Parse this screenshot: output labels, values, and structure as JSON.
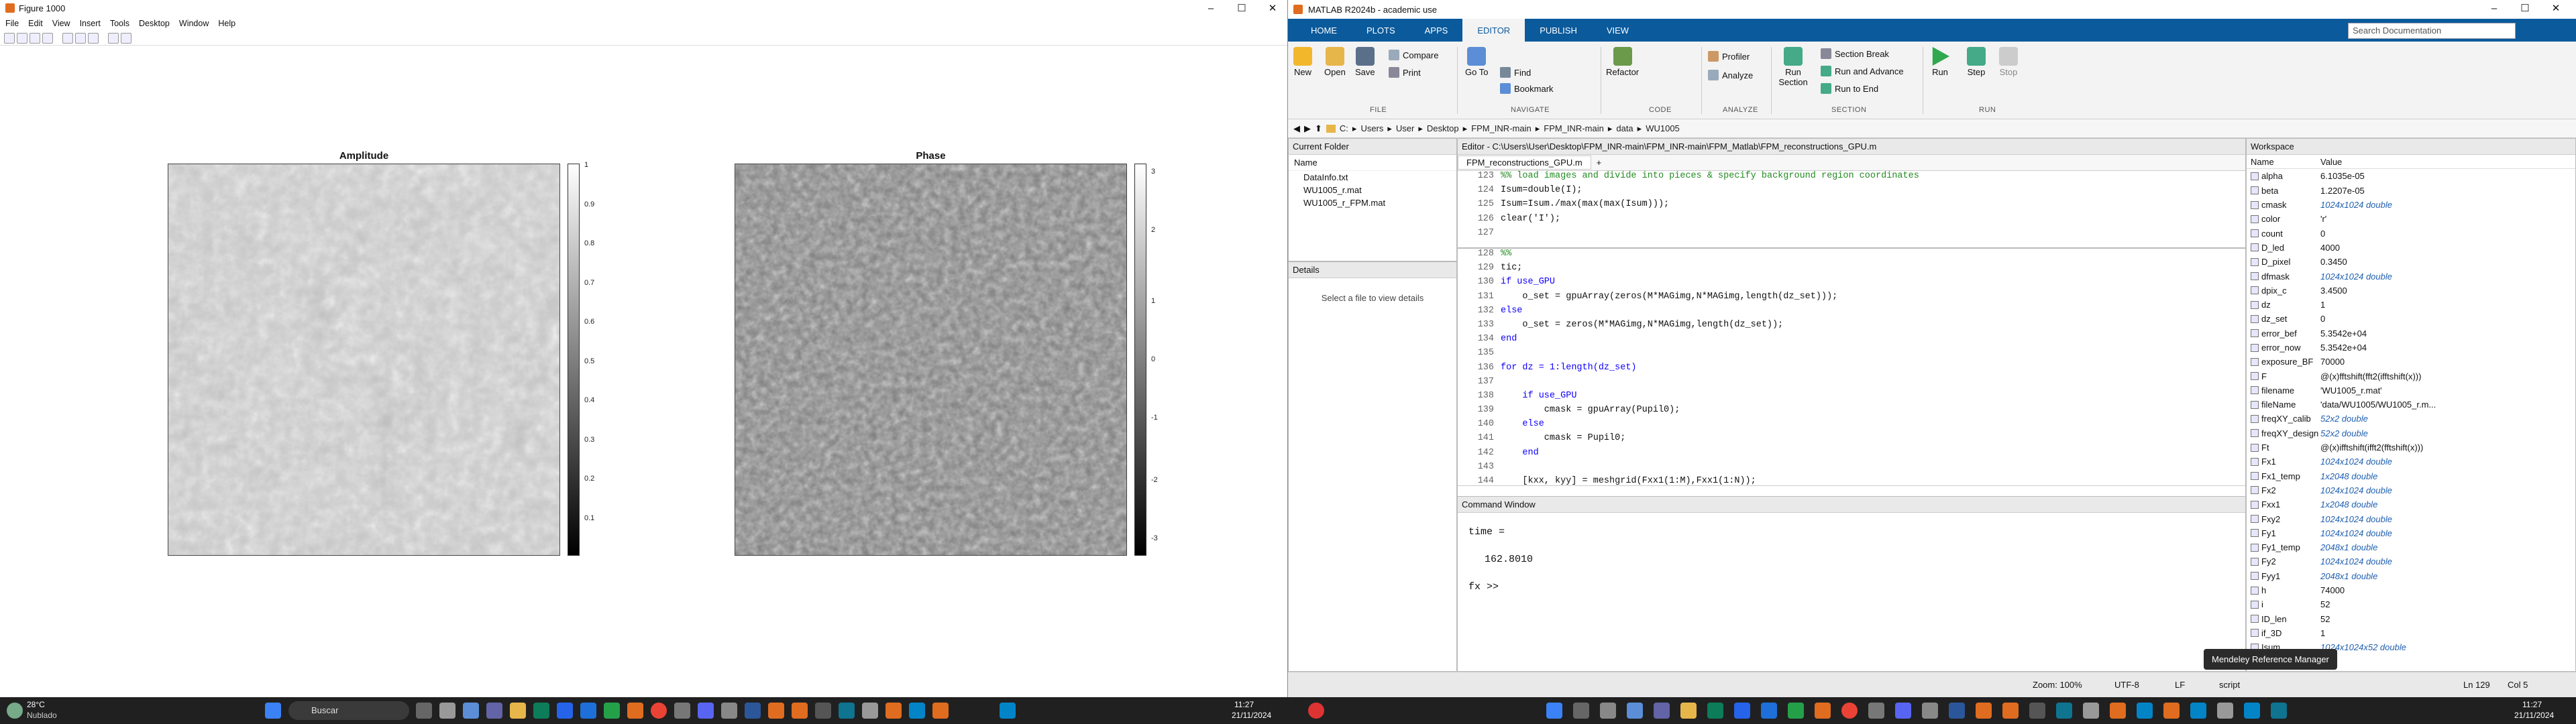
{
  "figure": {
    "title": "Figure 1000",
    "menu": [
      "File",
      "Edit",
      "View",
      "Insert",
      "Tools",
      "Desktop",
      "Window",
      "Help"
    ],
    "amplitude": {
      "title": "Amplitude",
      "ticks": [
        "1",
        "0.9",
        "0.8",
        "0.7",
        "0.6",
        "0.5",
        "0.4",
        "0.3",
        "0.2",
        "0.1"
      ]
    },
    "phase": {
      "title": "Phase",
      "ticks": [
        "3",
        "2",
        "1",
        "0",
        "-1",
        "-2",
        "-3"
      ]
    }
  },
  "matlab": {
    "title": "MATLAB R2024b - academic use",
    "tabs": [
      "HOME",
      "PLOTS",
      "APPS",
      "EDITOR",
      "PUBLISH",
      "VIEW"
    ],
    "active_tab": "EDITOR",
    "search_placeholder": "Search Documentation",
    "ribbon": {
      "file": {
        "label": "FILE",
        "new": "New",
        "open": "Open",
        "save": "Save",
        "compare": "Compare",
        "print": "Print"
      },
      "navigate": {
        "label": "NAVIGATE",
        "goto": "Go To",
        "find": "Find",
        "bookmark": "Bookmark"
      },
      "code": {
        "label": "CODE",
        "refactor": "Refactor"
      },
      "analyze": {
        "label": "ANALYZE",
        "profiler": "Profiler",
        "analyze": "Analyze"
      },
      "section": {
        "label": "SECTION",
        "run_section": "Run\nSection",
        "section_break": "Section Break",
        "run_advance": "Run and Advance",
        "run_end": "Run to End"
      },
      "run": {
        "label": "RUN",
        "run": "Run",
        "step": "Step",
        "stop": "Stop"
      }
    },
    "address": [
      "C:",
      "Users",
      "User",
      "Desktop",
      "FPM_INR-main",
      "FPM_INR-main",
      "data",
      "WU1005"
    ],
    "current_folder": {
      "title": "Current Folder",
      "header": "Name",
      "files": [
        "DataInfo.txt",
        "WU1005_r.mat",
        "WU1005_r_FPM.mat"
      ]
    },
    "details": {
      "title": "Details",
      "text": "Select a file to view details"
    },
    "editor": {
      "title": "Editor - C:\\Users\\User\\Desktop\\FPM_INR-main\\FPM_INR-main\\FPM_Matlab\\FPM_reconstructions_GPU.m",
      "tab": "FPM_reconstructions_GPU.m",
      "lines": [
        {
          "n": "123",
          "t": "%% load images and divide into pieces & specify background region coordinates",
          "c": "cm"
        },
        {
          "n": "124",
          "t": "Isum=double(I);",
          "c": ""
        },
        {
          "n": "125",
          "t": "Isum=Isum./max(max(max(Isum)));",
          "c": ""
        },
        {
          "n": "126",
          "t": "clear('I');",
          "c": ""
        },
        {
          "n": "127",
          "t": "",
          "c": ""
        },
        {
          "n": "128",
          "t": "%%",
          "c": "cm"
        },
        {
          "n": "129",
          "t": "tic;",
          "c": ""
        },
        {
          "n": "130",
          "t": "if use_GPU",
          "c": "kw"
        },
        {
          "n": "131",
          "t": "    o_set = gpuArray(zeros(M*MAGimg,N*MAGimg,length(dz_set)));",
          "c": ""
        },
        {
          "n": "132",
          "t": "else",
          "c": "kw"
        },
        {
          "n": "133",
          "t": "    o_set = zeros(M*MAGimg,N*MAGimg,length(dz_set));",
          "c": ""
        },
        {
          "n": "134",
          "t": "end",
          "c": "kw"
        },
        {
          "n": "135",
          "t": "",
          "c": ""
        },
        {
          "n": "136",
          "t": "for dz = 1:length(dz_set)",
          "c": "kw"
        },
        {
          "n": "137",
          "t": "",
          "c": ""
        },
        {
          "n": "138",
          "t": "    if use_GPU",
          "c": "kw"
        },
        {
          "n": "139",
          "t": "        cmask = gpuArray(Pupil0);",
          "c": ""
        },
        {
          "n": "140",
          "t": "    else",
          "c": "kw"
        },
        {
          "n": "141",
          "t": "        cmask = Pupil0;",
          "c": ""
        },
        {
          "n": "142",
          "t": "    end",
          "c": "kw"
        },
        {
          "n": "143",
          "t": "",
          "c": ""
        },
        {
          "n": "144",
          "t": "    [kxx, kyy] = meshgrid(Fxx1(1:M),Fxx1(1:N));",
          "c": ""
        }
      ]
    },
    "command": {
      "title": "Command Window",
      "l1": "time =",
      "l2": "162.8010",
      "prompt": "fx >>"
    },
    "workspace": {
      "title": "Workspace",
      "h_name": "Name",
      "h_value": "Value",
      "rows": [
        [
          "alpha",
          "6.1035e-05",
          ""
        ],
        [
          "beta",
          "1.2207e-05",
          ""
        ],
        [
          "cmask",
          "1024x1024 double",
          "b"
        ],
        [
          "color",
          "'r'",
          ""
        ],
        [
          "count",
          "0",
          ""
        ],
        [
          "D_led",
          "4000",
          ""
        ],
        [
          "D_pixel",
          "0.3450",
          ""
        ],
        [
          "dfmask",
          "1024x1024 double",
          "b"
        ],
        [
          "dpix_c",
          "3.4500",
          ""
        ],
        [
          "dz",
          "1",
          ""
        ],
        [
          "dz_set",
          "0",
          ""
        ],
        [
          "error_bef",
          "5.3542e+04",
          ""
        ],
        [
          "error_now",
          "5.3542e+04",
          ""
        ],
        [
          "exposure_BF",
          "70000",
          ""
        ],
        [
          "F",
          "@(x)fftshift(fft2(ifftshift(x)))",
          ""
        ],
        [
          "filename",
          "'WU1005_r.mat'",
          ""
        ],
        [
          "fileName",
          "'data/WU1005/WU1005_r.m...",
          ""
        ],
        [
          "freqXY_calib",
          "52x2 double",
          "b"
        ],
        [
          "freqXY_design",
          "52x2 double",
          "b"
        ],
        [
          "Ft",
          "@(x)ifftshift(ifft2(fftshift(x)))",
          ""
        ],
        [
          "Fx1",
          "1024x1024 double",
          "b"
        ],
        [
          "Fx1_temp",
          "1x2048 double",
          "b"
        ],
        [
          "Fx2",
          "1024x1024 double",
          "b"
        ],
        [
          "Fxx1",
          "1x2048 double",
          "b"
        ],
        [
          "Fxy2",
          "1024x1024 double",
          "b"
        ],
        [
          "Fy1",
          "1024x1024 double",
          "b"
        ],
        [
          "Fy1_temp",
          "2048x1 double",
          "b"
        ],
        [
          "Fy2",
          "1024x1024 double",
          "b"
        ],
        [
          "Fyy1",
          "2048x1 double",
          "b"
        ],
        [
          "h",
          "74000",
          ""
        ],
        [
          "i",
          "52",
          ""
        ],
        [
          "ID_len",
          "52",
          ""
        ],
        [
          "if_3D",
          "1",
          ""
        ],
        [
          "Isum",
          "1024x1024x52 double",
          "b"
        ]
      ]
    },
    "tooltip": "Mendeley Reference Manager",
    "status": {
      "zoom": "Zoom: 100%",
      "encoding": "UTF-8",
      "eol": "LF",
      "type": "script",
      "ln": "Ln 129",
      "col": "Col 5"
    }
  },
  "taskbar": {
    "weather_temp": "28°C",
    "weather_desc": "Nublado",
    "search": "Buscar",
    "left_time": "11:27",
    "left_date": "21/11/2024",
    "right_time": "11:27",
    "right_date": "21/11/2024"
  }
}
